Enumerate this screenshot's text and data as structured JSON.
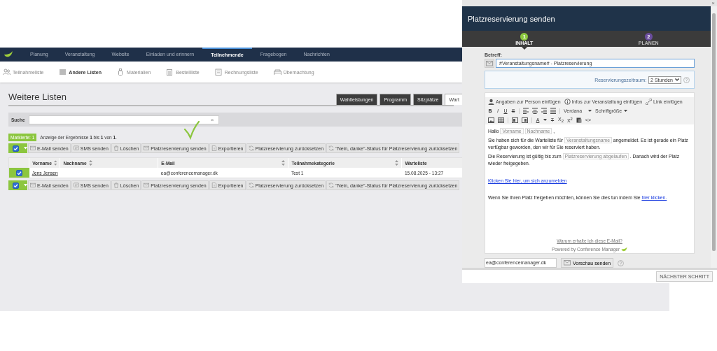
{
  "top_nav": {
    "items": [
      {
        "label": "Planung",
        "selected": false
      },
      {
        "label": "Veranstaltung",
        "selected": false
      },
      {
        "label": "Website",
        "selected": false
      },
      {
        "label": "Einladen und erinnern",
        "selected": false
      },
      {
        "label": "Teilnehmende",
        "selected": true
      },
      {
        "label": "Fragebogen",
        "selected": false
      },
      {
        "label": "Nachrichten",
        "selected": false
      }
    ]
  },
  "sub_nav": {
    "items": [
      {
        "label": "Teilnahmeliste",
        "selected": false
      },
      {
        "label": "Andere Listen",
        "selected": true
      },
      {
        "label": "Materialien",
        "selected": false
      },
      {
        "label": "Bestellliste",
        "selected": false
      },
      {
        "label": "Rechnungsliste",
        "selected": false
      },
      {
        "label": "Übernachtung",
        "selected": false
      }
    ]
  },
  "page_title": "Weitere Listen",
  "list_tabs": [
    {
      "label": "Wahlleistungen",
      "selected": false
    },
    {
      "label": "Programm",
      "selected": false
    },
    {
      "label": "Sitzplätze",
      "selected": false
    },
    {
      "label": "Wart",
      "selected": true
    }
  ],
  "search": {
    "label": "Suche",
    "clear": "×"
  },
  "selection_badge": "Markierte: 1",
  "result_info": "Anzeige der Ergebnisse **1** bis **1** von **1**.",
  "toolbar_top": [
    "E-Mail senden",
    "SMS senden",
    "Löschen",
    "Platzreservierung senden",
    "Exportieren",
    "Platzreservierung zurücksetzen",
    "\"Nein, danke\"-Status für Platzreservierung zurücksetzen"
  ],
  "toolbar_bottom": [
    "E-Mail senden",
    "SMS senden",
    "Löschen",
    "Platzreservierung senden",
    "Exportieren",
    "Platzreservierung zurücksetzen",
    "\"Nein, danke\"-Status für Platzreservierung zurücksetzen"
  ],
  "select_all_checked": true,
  "table": {
    "columns": [
      {
        "label": "Vorname",
        "sortable": true
      },
      {
        "label": "Nachname",
        "sortable": true
      },
      {
        "label": "E-Mail",
        "sortable": true
      },
      {
        "label": "Teilnahmekategorie",
        "sortable": true
      },
      {
        "label": "Warteliste",
        "sortable": false
      }
    ],
    "rows": [
      {
        "checked": true,
        "name": "Jens Jensen",
        "email": "ea@conferencemanager.dk",
        "category": "Test 1",
        "waitlist": "15.08.2025 - 13:27"
      }
    ]
  },
  "modal": {
    "title": "Platzreservierung senden",
    "close": "×",
    "steps": [
      {
        "number": "1",
        "label": "INHALT",
        "selected": true,
        "color": "#8cc63f"
      },
      {
        "number": "2",
        "label": "PLANEN",
        "selected": false,
        "color": "#6b4e9e"
      }
    ],
    "subject_label": "Betreff:",
    "subject": "#Veranstaltungsname# - Platzreservierung",
    "reservation_label": "Reservierungszeitraum:",
    "reservation_value": "2 Stunden",
    "insert_tools": [
      "Angaben zur Person einfügen",
      "Infos zur Veranstaltung einfügen",
      "Link einfügen"
    ],
    "format_buttons": [
      "B",
      "I",
      "U",
      "S"
    ],
    "font": "Verdana",
    "font_size": "Schriftgröße",
    "color_button": "A",
    "clear_format": "T",
    "subscript": "X$_{2}$",
    "superscript": "X$^{2}$",
    "source": "<>",
    "body": [
      [
        {
          "kind": "text",
          "text": "Hallo"
        },
        {
          "kind": "tag",
          "text": "Vorname"
        },
        {
          "kind": "tag",
          "text": "Nachname"
        },
        {
          "kind": "text",
          "text": ","
        }
      ],
      [
        {
          "kind": "text",
          "text": "Sie haben sich für die Warteliste für"
        },
        {
          "kind": "tag",
          "text": "Veranstaltungsname"
        },
        {
          "kind": "text",
          "text": "angemeldet. Es ist gerade ein Platz verfügbar geworden, den wir für Sie reserviert haben."
        }
      ],
      [
        {
          "kind": "text",
          "text": "Die Reservierung ist gültig bis zum"
        },
        {
          "kind": "tag",
          "text": "Platzreservierung abgelaufen"
        },
        {
          "kind": "text",
          "text": ". Danach wird der Platz wieder freigegeben."
        }
      ],
      [
        {
          "kind": "link",
          "text": "Klicken Sie hier, um sich anzumelden"
        }
      ],
      [
        {
          "kind": "text",
          "text": "Wenn Sie Ihren Platz freigeben möchten, können Sie dies tun indem Sie"
        },
        {
          "kind": "link",
          "text": "hier klicken."
        }
      ]
    ],
    "footer_link": "Warum erhalte ich diese E-Mail?",
    "powered_by": "Powered by Conference Manager",
    "preview_email": "ea@conferencemanager.dk",
    "preview_button": "Vorschau senden",
    "next_button": "NÄCHSTER SCHRITT"
  }
}
